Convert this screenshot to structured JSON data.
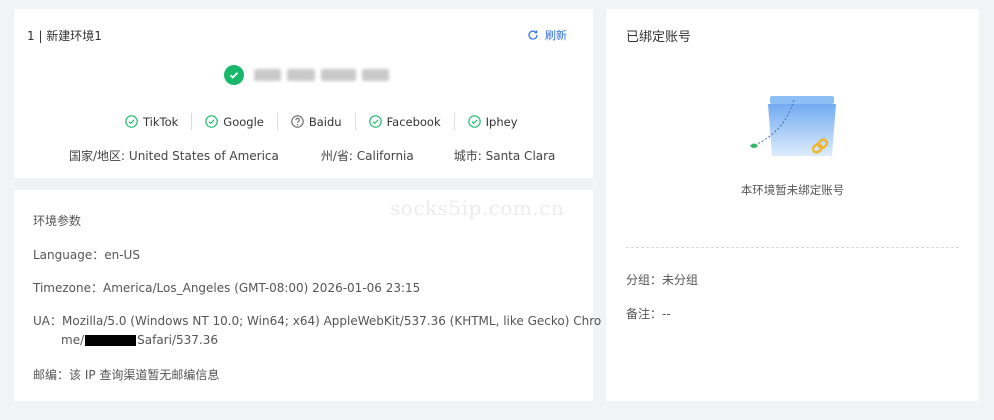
{
  "env": {
    "title": "1 | 新建环境1",
    "refresh_label": "刷新",
    "checks": [
      {
        "label": "TikTok",
        "status": "ok"
      },
      {
        "label": "Google",
        "status": "ok"
      },
      {
        "label": "Baidu",
        "status": "unknown"
      },
      {
        "label": "Facebook",
        "status": "ok"
      },
      {
        "label": "Iphey",
        "status": "ok"
      }
    ],
    "geo": {
      "country_label": "国家/地区: ",
      "country_value": "United States of America",
      "state_label": "州/省: ",
      "state_value": "California",
      "city_label": "城市: ",
      "city_value": "Santa Clara"
    }
  },
  "params": {
    "title": "环境参数",
    "language": "Language：en-US",
    "timezone": "Timezone：America/Los_Angeles (GMT-08:00) 2026-01-06 23:15",
    "ua_line1": "UA：Mozilla/5.0 (Windows NT 10.0; Win64; x64) AppleWebKit/537.36 (KHTML, like Gecko) Chro",
    "ua_line2_pre": "me/",
    "ua_line2_post": "Safari/537.36",
    "zipcode": "邮编：该 IP 查询渠道暂无邮编信息"
  },
  "watermark": "socks5ip.com.cn",
  "account": {
    "title": "已绑定账号",
    "empty_text": "本环境暂未绑定账号",
    "group": "分组：未分组",
    "note": "备注：--"
  },
  "colors": {
    "accent": "#2f6fe4",
    "success": "#18b86b",
    "background": "#f2f3f5"
  }
}
